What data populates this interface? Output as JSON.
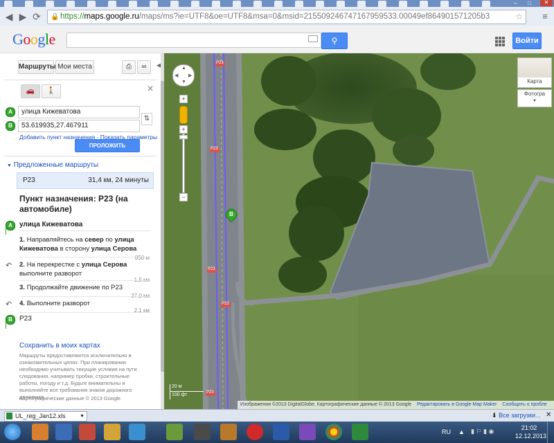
{
  "browser": {
    "url": "https://maps.google.ru/maps/ms?ie=UTF8&oe=UTF8&msa=0&msid=215509246747167959533.00049ef864901571205b3",
    "url_scheme": "https://",
    "url_host": "maps.google.ru",
    "url_rest": "/maps/ms?ie=UTF8&oe=UTF8&msa=0&msid=215509246747167959533.00049ef864901571205b3"
  },
  "header": {
    "logo": "Google",
    "search_placeholder": "",
    "signin_label": "Войти"
  },
  "panel": {
    "tabs": {
      "directions": "Маршруты",
      "my_places": "Мои места"
    },
    "from_value": "улица Кижеватова",
    "to_value": "53.619935,27.467911",
    "marker_a": "A",
    "marker_b": "B",
    "add_destination": "Добавить пункт назначения",
    "separator": " - ",
    "show_options": "Показать параметры",
    "route_button": "ПРОЛОЖИТЬ МАРШРУТ",
    "suggested_routes": "Предложенные маршруты",
    "route": {
      "name": "P23",
      "summary": "31,4 км, 24 минуты"
    },
    "destination_title": "Пункт назначения: P23 (на автомобиле)",
    "start_name": "улица Кижеватова",
    "steps": [
      {
        "num": "1.",
        "pre": "Направляйтесь на ",
        "b1": "север",
        "mid": " по ",
        "b2": "улица Кижеватова",
        "mid2": " в сторону ",
        "b3": "улица Серова",
        "dist": "850 м"
      },
      {
        "num": "2.",
        "pre": "На перекрестке с ",
        "b1": "улица Серова",
        "post": " выполните разворот",
        "dist": "1,5 км"
      },
      {
        "num": "3.",
        "text": "Продолжайте движение по ",
        "b1": "P23",
        "dist": "27,0 км"
      },
      {
        "num": "4.",
        "text": "Выполните разворот",
        "dist": "2,1 км"
      }
    ],
    "end_name": "P23",
    "save_link": "Сохранить в моих картах",
    "disclaimer": "Маршруты предоставляются исключительно в ознакомительных целях. При планировании необходимо учитывать текущие условия на пути следования, например пробки, строительные работы, погоду и т.д. Будьте внимательны и выполняйте все требования знаков дорожного движения.",
    "copyright": "Картографические данные © 2013 Google"
  },
  "map": {
    "type_map": "Карта",
    "type_photo": "Фотогра",
    "road_label": "P23",
    "marker_b": "B",
    "scale_top": "20 м",
    "scale_bottom": "100 фт",
    "attribution": "Изображения ©2013 DigitalGlobe, Картографические данные © 2013 Google",
    "edit_link": "Редактировать в Google Map Maker",
    "report_link": "Сообщить о пробле"
  },
  "status": {
    "download_file": "UL_reg_Jan12.xls",
    "all_downloads": "Все загрузки..."
  },
  "taskbar": {
    "lang": "RU",
    "time": "21:02",
    "date": "12.12.2013"
  },
  "colors": {
    "accent": "#4b8bf4",
    "link": "#1a4fbb",
    "marker": "#37a62c",
    "route": "#6b5cff"
  }
}
